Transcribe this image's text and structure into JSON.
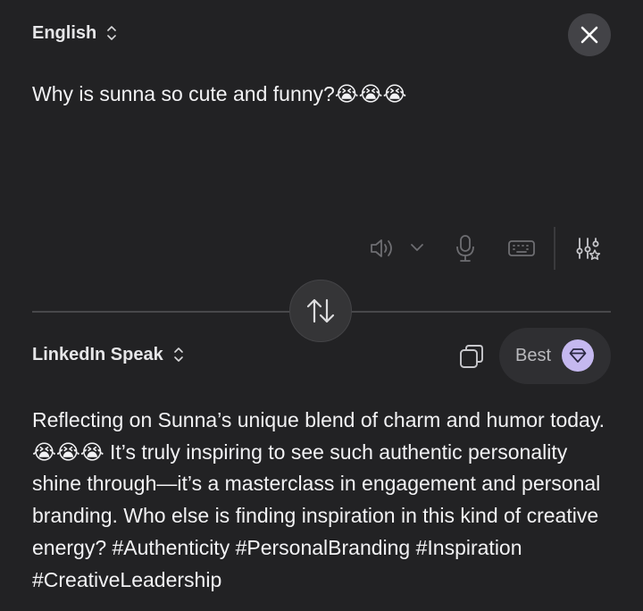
{
  "source": {
    "language": "English",
    "text": "Why is sunna so cute and funny?😭😭😭"
  },
  "target": {
    "language": "LinkedIn Speak",
    "quality_label": "Best",
    "text": "Reflecting on Sunna’s unique blend of charm and humor today. 😭😭😭 It’s truly inspiring to see such authentic personality shine through—it’s a masterclass in engagement and personal branding. Who else is finding inspiration in this kind of creative energy? #Authenticity #PersonalBranding #Inspiration #CreativeLeadership"
  },
  "icons": {
    "close": "close-icon",
    "speaker": "speaker-icon",
    "chevron": "chevron-down-icon",
    "mic": "microphone-icon",
    "keyboard": "keyboard-icon",
    "settings": "sliders-star-icon",
    "swap": "swap-icon",
    "copy": "copy-icon",
    "gem": "gem-icon"
  },
  "colors": {
    "background": "#222224",
    "accent": "#c5b8ef"
  }
}
